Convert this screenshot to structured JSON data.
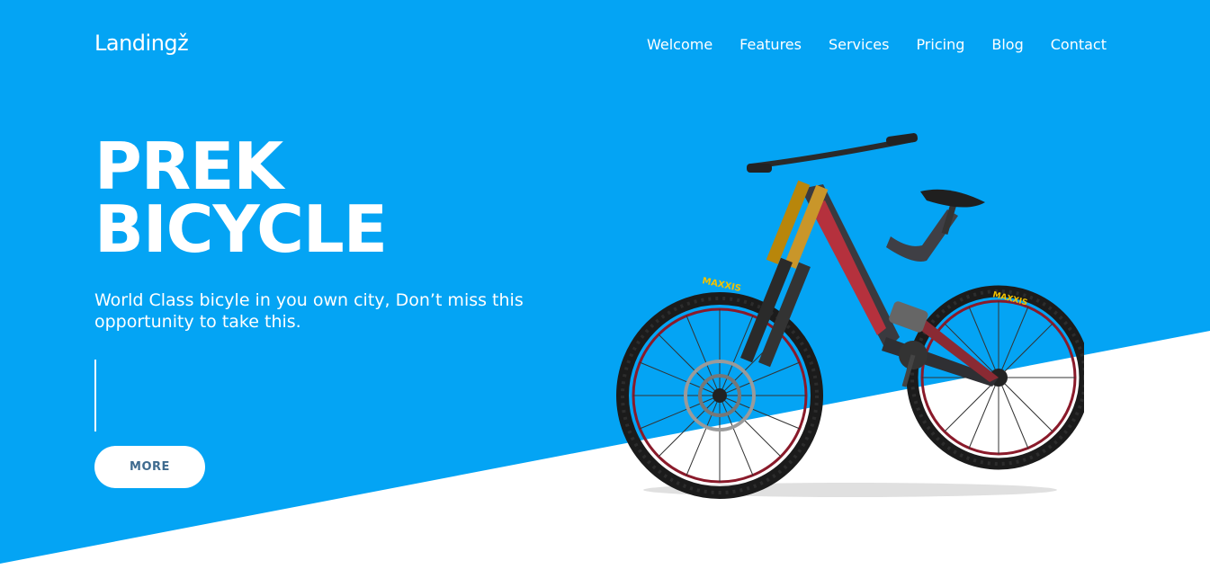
{
  "brand": {
    "logo": "Landingž"
  },
  "nav": {
    "links": [
      {
        "label": "Welcome"
      },
      {
        "label": "Features"
      },
      {
        "label": "Services"
      },
      {
        "label": "Pricing"
      },
      {
        "label": "Blog"
      },
      {
        "label": "Contact"
      }
    ]
  },
  "hero": {
    "title_line1": "PREK",
    "title_line2": "BICYCLE",
    "subtitle": "World Class bicyle in you own city, Don’t miss this opportunity to take this.",
    "more_label": "MORE",
    "tire_brand": "MAXXIS"
  },
  "colors": {
    "hero_blue": "#04a4f4",
    "button_text": "#3f6b8f"
  }
}
